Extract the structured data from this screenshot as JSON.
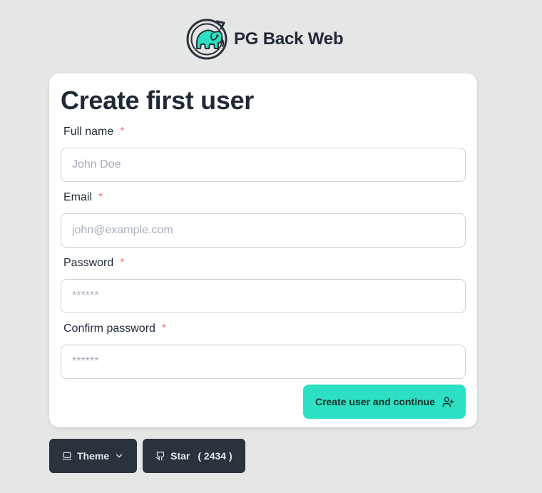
{
  "brand": {
    "name": "PG Back Web",
    "logo_icon": "elephant-logo-icon",
    "accent": "#2de0c3"
  },
  "form": {
    "title": "Create first user",
    "fields": [
      {
        "label": "Full name",
        "required_mark": "*",
        "placeholder": "John Doe",
        "value": ""
      },
      {
        "label": "Email",
        "required_mark": "*",
        "placeholder": "john@example.com",
        "value": ""
      },
      {
        "label": "Password",
        "required_mark": "*",
        "placeholder": "******",
        "value": ""
      },
      {
        "label": "Confirm password",
        "required_mark": "*",
        "placeholder": "******",
        "value": ""
      }
    ],
    "submit_label": "Create user and continue",
    "submit_icon": "user-plus-icon"
  },
  "footer": {
    "theme_label": "Theme",
    "theme_icon": "laptop-icon",
    "theme_chevron_icon": "chevron-down-icon",
    "star_label": "Star",
    "star_icon": "github-icon",
    "star_count": "( 2434 )"
  },
  "colors": {
    "background": "#e5e6e6",
    "card": "#ffffff",
    "primary": "#2de0c3",
    "dark_button": "#2a323c",
    "required": "#f87272",
    "text": "#1f2937"
  }
}
